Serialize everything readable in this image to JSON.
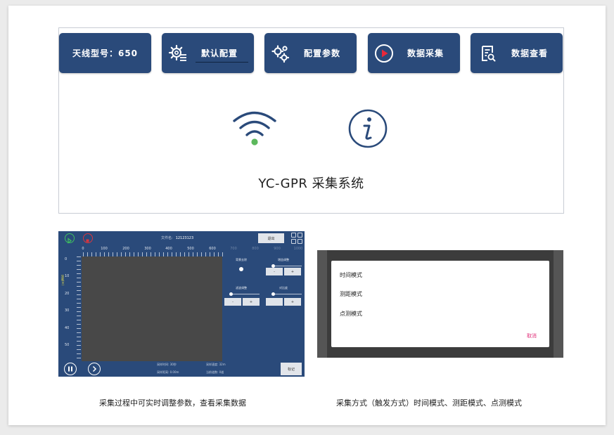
{
  "menu": {
    "antenna_model": "天线型号：650",
    "default_config": "默认配置",
    "config_params": "配置参数",
    "data_collect": "数据采集",
    "data_view": "数据查看"
  },
  "system_title": "YC-GPR 采集系统",
  "accent_color": "#2a4a7a",
  "wifi_status_color": "#5cb85c",
  "icons": [
    "gear-list-icon",
    "gears-icon",
    "play-circle-icon",
    "document-search-icon",
    "wifi-icon",
    "info-icon"
  ],
  "screenshot1": {
    "file_label": "文件名:",
    "file_name": "12123123",
    "exit_label": "退出",
    "x_ticks": [
      "0",
      "100",
      "200",
      "300",
      "400",
      "500",
      "600",
      "700",
      "800",
      "900",
      "1000"
    ],
    "y_ticks": [
      "0",
      "10",
      "20",
      "30",
      "40",
      "50"
    ],
    "depth_label": "深度(m)",
    "controls": {
      "bg_removal": "背景去除",
      "gain_adjust": "增益调整",
      "filter_adjust": "滤波调整",
      "contrast": "对比度",
      "minus": "-",
      "plus": "+"
    },
    "stats": {
      "collect_time": "采样时间: 30秒",
      "sample_speed": "采样速度: 32m",
      "collect_distance": "采样距离: 0.00m",
      "current_depth": "当前道数: 0道"
    },
    "mark_label": "标记"
  },
  "screenshot2": {
    "modes": [
      "时间模式",
      "测距模式",
      "点测模式"
    ],
    "cancel": "取消"
  },
  "captions": {
    "left": "采集过程中可实时调整参数，查看采集数据",
    "right": "采集方式（触发方式）时间模式、测距模式、点测模式"
  }
}
